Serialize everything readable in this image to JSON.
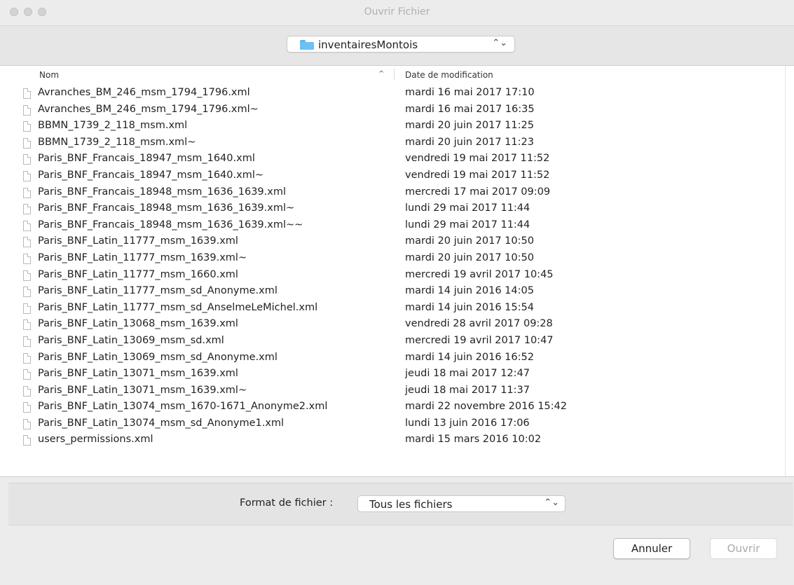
{
  "window": {
    "title": "Ouvrir Fichier"
  },
  "folder": {
    "name": "inventairesMontois",
    "icon": "folder-icon"
  },
  "list": {
    "headers": {
      "name": "Nom",
      "date": "Date de modification",
      "sort_icon": "^"
    },
    "files": [
      {
        "name": "Avranches_BM_246_msm_1794_1796.xml",
        "date": "mardi 16 mai 2017 17:10"
      },
      {
        "name": "Avranches_BM_246_msm_1794_1796.xml~",
        "date": "mardi 16 mai 2017 16:35"
      },
      {
        "name": "BBMN_1739_2_118_msm.xml",
        "date": "mardi 20 juin 2017 11:25"
      },
      {
        "name": "BBMN_1739_2_118_msm.xml~",
        "date": "mardi 20 juin 2017 11:23"
      },
      {
        "name": "Paris_BNF_Francais_18947_msm_1640.xml",
        "date": "vendredi 19 mai 2017 11:52"
      },
      {
        "name": "Paris_BNF_Francais_18947_msm_1640.xml~",
        "date": "vendredi 19 mai 2017 11:52"
      },
      {
        "name": "Paris_BNF_Francais_18948_msm_1636_1639.xml",
        "date": "mercredi 17 mai 2017 09:09"
      },
      {
        "name": "Paris_BNF_Francais_18948_msm_1636_1639.xml~",
        "date": "lundi 29 mai 2017 11:44"
      },
      {
        "name": "Paris_BNF_Francais_18948_msm_1636_1639.xml~~",
        "date": "lundi 29 mai 2017 11:44"
      },
      {
        "name": "Paris_BNF_Latin_11777_msm_1639.xml",
        "date": "mardi 20 juin 2017 10:50"
      },
      {
        "name": "Paris_BNF_Latin_11777_msm_1639.xml~",
        "date": "mardi 20 juin 2017 10:50"
      },
      {
        "name": "Paris_BNF_Latin_11777_msm_1660.xml",
        "date": "mercredi 19 avril 2017 10:45"
      },
      {
        "name": "Paris_BNF_Latin_11777_msm_sd_Anonyme.xml",
        "date": "mardi 14 juin 2016 14:05"
      },
      {
        "name": "Paris_BNF_Latin_11777_msm_sd_AnselmeLeMichel.xml",
        "date": "mardi 14 juin 2016 15:54"
      },
      {
        "name": "Paris_BNF_Latin_13068_msm_1639.xml",
        "date": "vendredi 28 avril 2017 09:28"
      },
      {
        "name": "Paris_BNF_Latin_13069_msm_sd.xml",
        "date": "mercredi 19 avril 2017 10:47"
      },
      {
        "name": "Paris_BNF_Latin_13069_msm_sd_Anonyme.xml",
        "date": "mardi 14 juin 2016 16:52"
      },
      {
        "name": "Paris_BNF_Latin_13071_msm_1639.xml",
        "date": "jeudi 18 mai 2017 12:47"
      },
      {
        "name": "Paris_BNF_Latin_13071_msm_1639.xml~",
        "date": "jeudi 18 mai 2017 11:37"
      },
      {
        "name": "Paris_BNF_Latin_13074_msm_1670-1671_Anonyme2.xml",
        "date": "mardi 22 novembre 2016 15:42"
      },
      {
        "name": "Paris_BNF_Latin_13074_msm_sd_Anonyme1.xml",
        "date": "lundi 13 juin 2016 17:06"
      },
      {
        "name": "users_permissions.xml",
        "date": "mardi 15 mars 2016 10:02"
      }
    ]
  },
  "format": {
    "label": "Format de fichier :",
    "value": "Tous les fichiers"
  },
  "buttons": {
    "cancel": "Annuler",
    "open": "Ouvrir"
  },
  "colors": {
    "folder_blue": "#6cc1f4",
    "disabled_text": "#a9a9a9"
  }
}
